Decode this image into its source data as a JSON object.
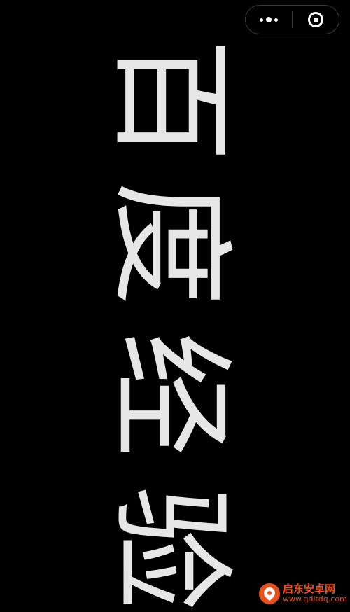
{
  "capsule": {
    "more_icon": "more-dots-icon",
    "close_icon": "target-close-icon"
  },
  "content": {
    "characters": [
      "百",
      "度",
      "经",
      "验"
    ],
    "text_color": "#e6e6e6",
    "background": "#000000"
  },
  "watermark": {
    "name": "启东安卓网",
    "url": "www.qdltdq.com",
    "color": "#e94e1b"
  }
}
